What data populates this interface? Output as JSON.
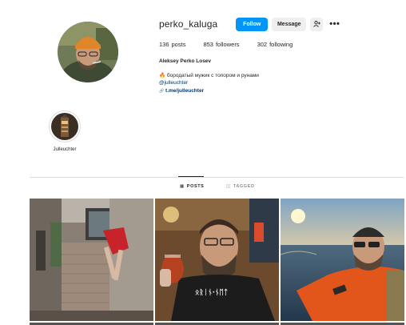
{
  "profile": {
    "username": "perko_kaluga",
    "follow_label": "Follow",
    "message_label": "Message",
    "suggest_icon": "person-add-icon",
    "more_icon": "more-dots-icon",
    "more_glyph": "•••",
    "stats": {
      "posts_count": "136",
      "posts_label": "posts",
      "followers_count": "853",
      "followers_label": "followers",
      "following_count": "302",
      "following_label": "following"
    },
    "full_name": "Aleksey Perko Losev",
    "bio_line": "бородатый мужик с топором и рунами",
    "bio_emoji": "🔥",
    "mention": "@julleuchter",
    "link_glyph": "🔗",
    "link": "t.me/julleuchter"
  },
  "highlights": [
    {
      "label": "Julleuchter"
    }
  ],
  "tabs": {
    "posts_glyph": "▦",
    "posts_label": "POSTS",
    "tagged_glyph": "◫",
    "tagged_label": "TAGGED"
  },
  "posts": [
    {
      "icon": "climbing-window-photo"
    },
    {
      "icon": "bearded-man-drink-photo",
      "shirt_text": "ᛟᚱᛁᚾ·ᚾᛖᛏ"
    },
    {
      "icon": "man-on-boat-photo"
    }
  ],
  "colors": {
    "primary_blue": "#0095f6",
    "link_blue": "#00376b",
    "secondary_button": "#efefef",
    "divider": "#dbdbdb"
  }
}
